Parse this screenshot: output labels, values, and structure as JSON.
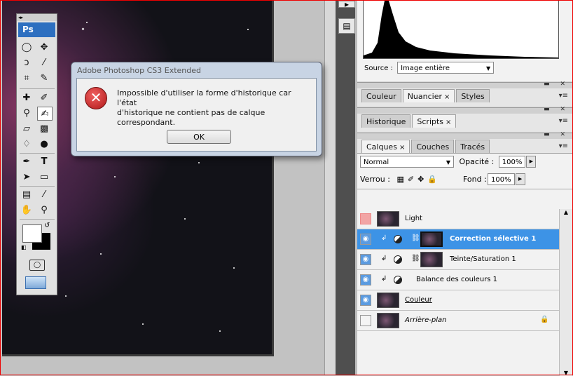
{
  "dialog": {
    "title": "Adobe Photoshop CS3 Extended",
    "message_line1": "Impossible d'utiliser la forme d'historique car l'état",
    "message_line2": "d'historique ne contient pas de calque",
    "message_line3": "correspondant.",
    "ok_label": "OK",
    "icon": "error-icon"
  },
  "toolbox": {
    "logo": "Ps",
    "header": "◂▸"
  },
  "histogram": {
    "source_label": "Source :",
    "source_value": "Image entière"
  },
  "panel_group1": {
    "tabs": [
      {
        "label": "Couleur"
      },
      {
        "label": "Nuancier",
        "close": "×"
      },
      {
        "label": "Styles"
      }
    ]
  },
  "panel_group2": {
    "tabs": [
      {
        "label": "Historique"
      },
      {
        "label": "Scripts",
        "close": "×"
      }
    ]
  },
  "layers_panel": {
    "tabs": [
      {
        "label": "Calques",
        "close": "×"
      },
      {
        "label": "Couches"
      },
      {
        "label": "Tracés"
      }
    ],
    "blend_mode": "Normal",
    "opacity_label": "Opacité :",
    "opacity_value": "100%",
    "lock_label": "Verrou :",
    "fill_label": "Fond :",
    "fill_value": "100%",
    "layers": [
      {
        "name": "Light",
        "visible": false,
        "selected": false
      },
      {
        "name": "Correction sélective 1",
        "visible": true,
        "selected": true
      },
      {
        "name": "Teinte/Saturation 1",
        "visible": true,
        "selected": false
      },
      {
        "name": "Balance des couleurs 1",
        "visible": true,
        "selected": false
      },
      {
        "name": "Couleur",
        "visible": true,
        "selected": false
      },
      {
        "name": "Arrière-plan",
        "visible": false,
        "selected": false
      }
    ]
  },
  "colors": {
    "selection": "#3d93e6",
    "frame": "#e00000",
    "ps_logo": "#2d6fc0"
  }
}
